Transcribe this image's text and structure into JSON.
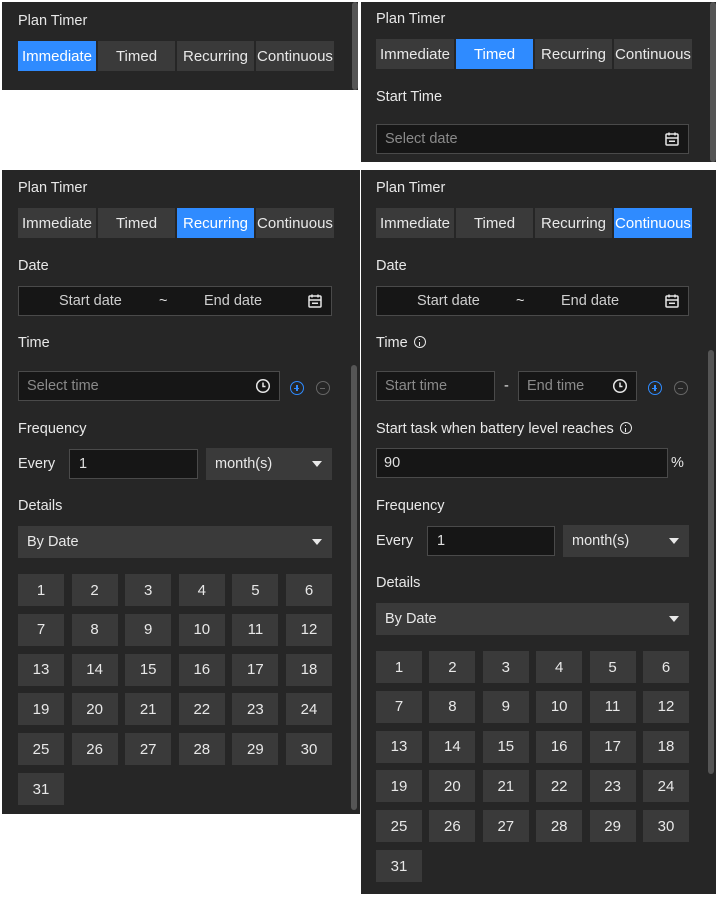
{
  "title": "Plan Timer",
  "modes": [
    "Immediate",
    "Timed",
    "Recurring",
    "Continuous"
  ],
  "timed": {
    "start_time_label": "Start Time",
    "date_placeholder": "Select date"
  },
  "recurring": {
    "date_label": "Date",
    "start_date": "Start date",
    "tilde": "~",
    "end_date": "End date",
    "time_label": "Time",
    "time_placeholder": "Select time",
    "frequency_label": "Frequency",
    "every_label": "Every",
    "every_value": "1",
    "unit": "month(s)",
    "details_label": "Details",
    "details_value": "By Date"
  },
  "continuous": {
    "date_label": "Date",
    "start_date": "Start date",
    "tilde": "~",
    "end_date": "End date",
    "time_label": "Time",
    "start_time_placeholder": "Start time",
    "dash": "-",
    "end_time_placeholder": "End time",
    "battery_label": "Start task when battery level reaches",
    "battery_value": "90",
    "percent": "%",
    "frequency_label": "Frequency",
    "every_label": "Every",
    "every_value": "1",
    "unit": "month(s)",
    "details_label": "Details",
    "details_value": "By Date"
  },
  "days": [
    "1",
    "2",
    "3",
    "4",
    "5",
    "6",
    "7",
    "8",
    "9",
    "10",
    "11",
    "12",
    "13",
    "14",
    "15",
    "16",
    "17",
    "18",
    "19",
    "20",
    "21",
    "22",
    "23",
    "24",
    "25",
    "26",
    "27",
    "28",
    "29",
    "30",
    "31"
  ],
  "colors": {
    "panel": "#262626",
    "accent": "#2f8bff",
    "button": "#3a3a3a"
  }
}
